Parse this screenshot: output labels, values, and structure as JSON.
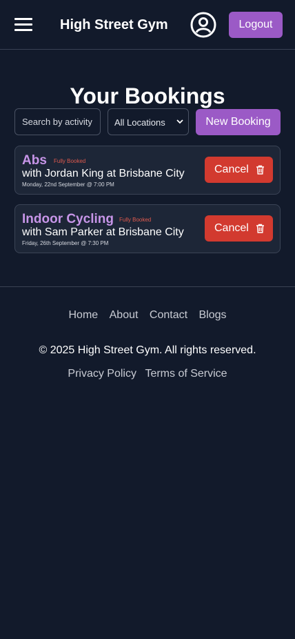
{
  "header": {
    "brand": "High Street Gym",
    "logout_label": "Logout",
    "menu_icon": "hamburger-menu-icon",
    "profile_icon": "user-circle-icon"
  },
  "page": {
    "title": "Your Bookings"
  },
  "filters": {
    "search_placeholder": "Search by activity",
    "location_selected": "All Locations",
    "new_booking_label": "New Booking"
  },
  "bookings": [
    {
      "activity": "Abs",
      "status": "Fully Booked",
      "detail": "with Jordan King at Brisbane City",
      "datetime": "Monday, 22nd September @ 7:00 PM",
      "cancel_label": "Cancel"
    },
    {
      "activity": "Indoor Cycling",
      "status": "Fully Booked",
      "detail": "with Sam Parker at Brisbane City",
      "datetime": "Friday, 26th September @ 7:30 PM",
      "cancel_label": "Cancel"
    }
  ],
  "footer": {
    "nav": [
      "Home",
      "About",
      "Contact",
      "Blogs"
    ],
    "copyright": "© 2025 High Street Gym. All rights reserved.",
    "legal": [
      "Privacy Policy",
      "Terms of Service"
    ]
  },
  "colors": {
    "background": "#121a2b",
    "accent": "#9b5ac6",
    "danger": "#d23a2f",
    "activity_text": "#c795e8"
  }
}
